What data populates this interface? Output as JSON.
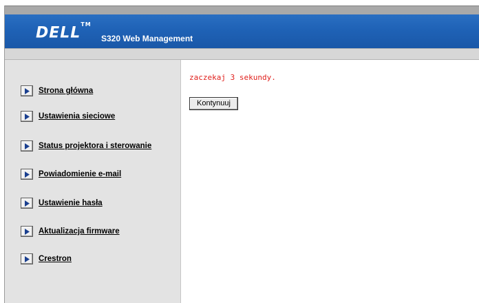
{
  "header": {
    "brand": "DELL",
    "trademark": "TM",
    "title": "S320 Web Management",
    "color": "#1f62b6"
  },
  "sidebar": {
    "items": [
      {
        "label": "Strona główna",
        "icon": "arrow-right-icon"
      },
      {
        "label": "Ustawienia sieciowe",
        "icon": "arrow-right-icon"
      },
      {
        "label": "Status projektora i sterowanie",
        "icon": "arrow-right-icon"
      },
      {
        "label": "Powiadomienie e-mail",
        "icon": "arrow-right-icon"
      },
      {
        "label": "Ustawienie hasła",
        "icon": "arrow-right-icon"
      },
      {
        "label": "Aktualizacja firmware",
        "icon": "arrow-right-icon"
      },
      {
        "label": "Crestron",
        "icon": "arrow-right-icon"
      }
    ]
  },
  "main": {
    "message": "zaczekaj 3 sekundy.",
    "message_color": "#e0201c",
    "continue_label": "Kontynuuj"
  }
}
